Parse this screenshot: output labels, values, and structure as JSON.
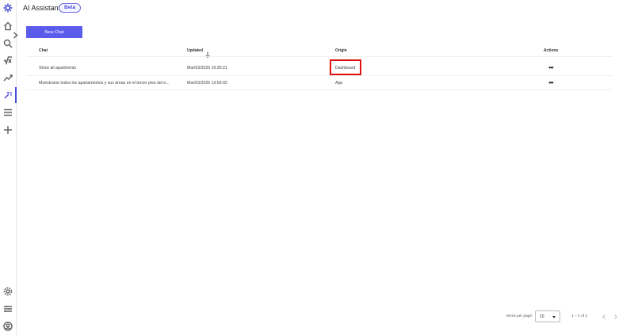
{
  "app": {
    "title": "AI Assistant",
    "badge": "Beta"
  },
  "toolbar": {
    "new_chat_label": "New Chat"
  },
  "table": {
    "headers": {
      "chat": "Chat",
      "updated": "Updated",
      "origin": "Origin",
      "actions": "Actions"
    },
    "rows": [
      {
        "chat": "Show all apartments",
        "updated": "Mar/03/2025 16:30:21",
        "origin": "Dashboard",
        "actions": "•••"
      },
      {
        "chat": "Muéstrame todos los apartamentos y sus áreas en el tercer piso del e...",
        "updated": "Mar/03/2025 13:59:02",
        "origin": "App",
        "actions": "•••"
      }
    ]
  },
  "pagination": {
    "items_per_page_label": "Items per page:",
    "page_size": "10",
    "range": "1 – 2 of 2"
  },
  "colors": {
    "accent": "#5b5bec",
    "highlight": "#e01010"
  }
}
